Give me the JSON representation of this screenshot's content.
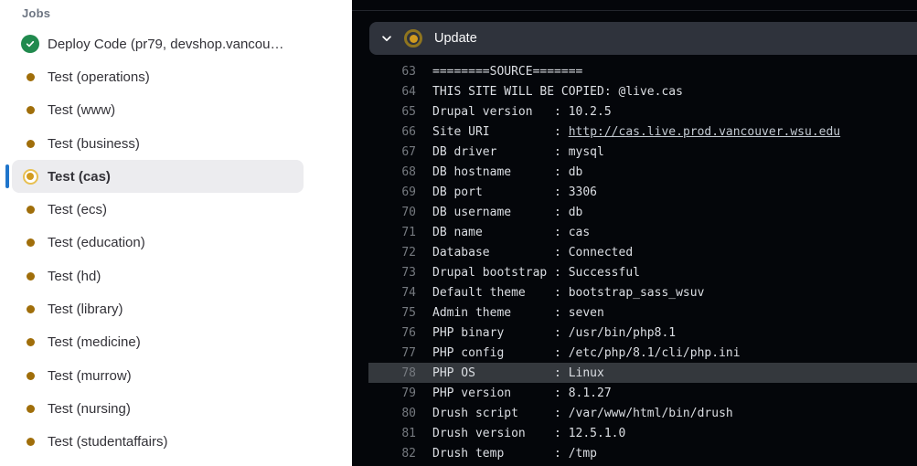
{
  "sidebar": {
    "title": "Jobs",
    "items": [
      {
        "label": "Deploy Code (pr79, devshop.vancou…",
        "status": "success",
        "selected": false
      },
      {
        "label": "Test (operations)",
        "status": "pending",
        "selected": false
      },
      {
        "label": "Test (www)",
        "status": "pending",
        "selected": false
      },
      {
        "label": "Test (business)",
        "status": "pending",
        "selected": false
      },
      {
        "label": "Test (cas)",
        "status": "running",
        "selected": true
      },
      {
        "label": "Test (ecs)",
        "status": "pending",
        "selected": false
      },
      {
        "label": "Test (education)",
        "status": "pending",
        "selected": false
      },
      {
        "label": "Test (hd)",
        "status": "pending",
        "selected": false
      },
      {
        "label": "Test (library)",
        "status": "pending",
        "selected": false
      },
      {
        "label": "Test (medicine)",
        "status": "pending",
        "selected": false
      },
      {
        "label": "Test (murrow)",
        "status": "pending",
        "selected": false
      },
      {
        "label": "Test (nursing)",
        "status": "pending",
        "selected": false
      },
      {
        "label": "Test (studentaffairs)",
        "status": "pending",
        "selected": false
      }
    ]
  },
  "log_panel": {
    "section": {
      "label": "Update",
      "status": "running"
    },
    "lines": [
      {
        "num": "63",
        "text": "========SOURCE======="
      },
      {
        "num": "64",
        "text": "THIS SITE WILL BE COPIED: @live.cas"
      },
      {
        "num": "65",
        "text": "Drupal version   : 10.2.5"
      },
      {
        "num": "66",
        "text": "Site URI         : ",
        "link": "http://cas.live.prod.vancouver.wsu.edu"
      },
      {
        "num": "67",
        "text": "DB driver        : mysql"
      },
      {
        "num": "68",
        "text": "DB hostname      : db"
      },
      {
        "num": "69",
        "text": "DB port          : 3306"
      },
      {
        "num": "70",
        "text": "DB username      : db"
      },
      {
        "num": "71",
        "text": "DB name          : cas"
      },
      {
        "num": "72",
        "text": "Database         : Connected"
      },
      {
        "num": "73",
        "text": "Drupal bootstrap : Successful"
      },
      {
        "num": "74",
        "text": "Default theme    : bootstrap_sass_wsuv"
      },
      {
        "num": "75",
        "text": "Admin theme      : seven"
      },
      {
        "num": "76",
        "text": "PHP binary       : /usr/bin/php8.1"
      },
      {
        "num": "77",
        "text": "PHP config       : /etc/php/8.1/cli/php.ini"
      },
      {
        "num": "78",
        "text": "PHP OS           : Linux",
        "highlighted": true
      },
      {
        "num": "79",
        "text": "PHP version      : 8.1.27"
      },
      {
        "num": "80",
        "text": "Drush script     : /var/www/html/bin/drush"
      },
      {
        "num": "81",
        "text": "Drush version    : 12.5.1.0"
      },
      {
        "num": "82",
        "text": "Drush temp       : /tmp"
      }
    ]
  },
  "colors": {
    "accent_blue": "#1f75cb",
    "status_gold": "#d09a1f",
    "status_pending_dot": "#a06e0a",
    "status_success_green": "#218a4e",
    "selected_row_bg": "#ececef",
    "panel_bg": "#04060a",
    "section_bar_bg": "#2f333c",
    "highlight_row_bg": "#34383d",
    "log_text": "#dbdee3",
    "line_number": "#75797f"
  }
}
